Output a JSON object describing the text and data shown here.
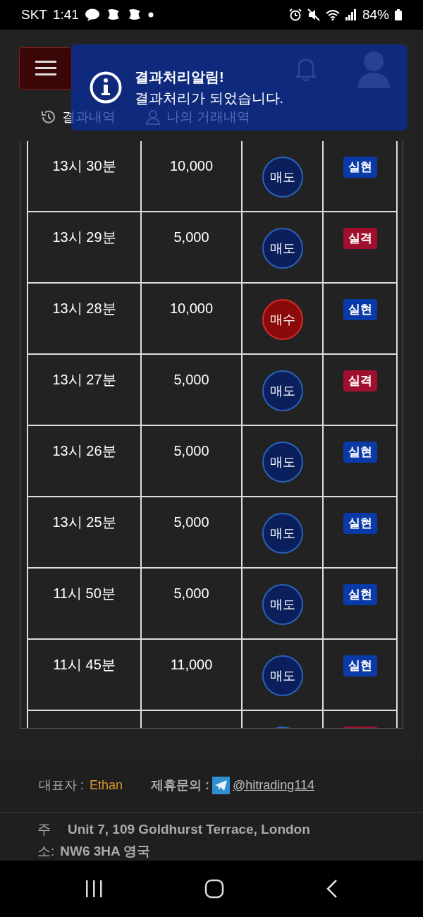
{
  "status_bar": {
    "carrier": "SKT",
    "time": "1:41",
    "battery": "84%"
  },
  "header": {
    "tabs": [
      {
        "label": "결과내역"
      },
      {
        "label": "나의 거래내역"
      }
    ]
  },
  "toast": {
    "title": "결과처리알림!",
    "message": "결과처리가 되었습니다."
  },
  "rows": [
    {
      "time": "13시 30분",
      "amount": "10,000",
      "side": {
        "kind": "sell",
        "label": "매도"
      },
      "result": {
        "kind": "win",
        "label": "실현"
      }
    },
    {
      "time": "13시 29분",
      "amount": "5,000",
      "side": {
        "kind": "sell",
        "label": "매도"
      },
      "result": {
        "kind": "loss",
        "label": "실격"
      }
    },
    {
      "time": "13시 28분",
      "amount": "10,000",
      "side": {
        "kind": "buy",
        "label": "매수"
      },
      "result": {
        "kind": "win",
        "label": "실현"
      }
    },
    {
      "time": "13시 27분",
      "amount": "5,000",
      "side": {
        "kind": "sell",
        "label": "매도"
      },
      "result": {
        "kind": "loss",
        "label": "실격"
      }
    },
    {
      "time": "13시 26분",
      "amount": "5,000",
      "side": {
        "kind": "sell",
        "label": "매도"
      },
      "result": {
        "kind": "win",
        "label": "실현"
      }
    },
    {
      "time": "13시 25분",
      "amount": "5,000",
      "side": {
        "kind": "sell",
        "label": "매도"
      },
      "result": {
        "kind": "win",
        "label": "실현"
      }
    },
    {
      "time": "11시 50분",
      "amount": "5,000",
      "side": {
        "kind": "sell",
        "label": "매도"
      },
      "result": {
        "kind": "win",
        "label": "실현"
      }
    },
    {
      "time": "11시 45분",
      "amount": "11,000",
      "side": {
        "kind": "sell",
        "label": "매도"
      },
      "result": {
        "kind": "win",
        "label": "실현"
      }
    },
    {
      "side": {
        "kind": "sell"
      },
      "result": {
        "kind": "loss"
      }
    }
  ],
  "footer": {
    "ceo_label": "대표자 :",
    "ceo": "Ethan",
    "contact_label": "제휴문의 :",
    "contact": " @hitrading114",
    "address_label_1": "주",
    "address_1": "Unit 7, 109 Goldhurst Terrace, London",
    "address_label_2": "소:",
    "address_2": "NW6 3HA 영국"
  }
}
